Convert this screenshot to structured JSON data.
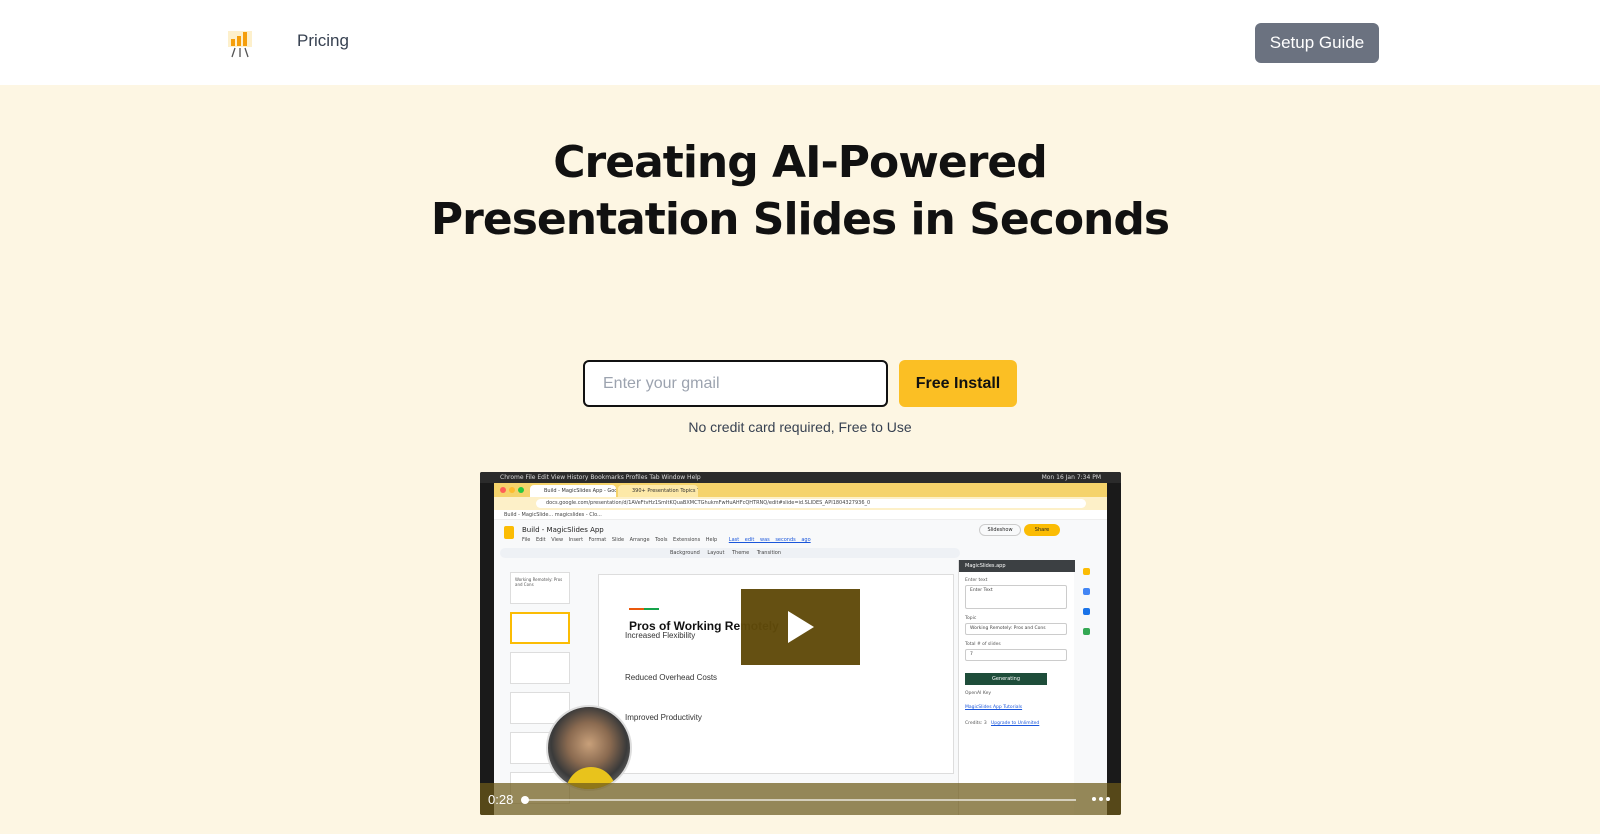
{
  "header": {
    "logo_icon": "bar-chart-easel-icon",
    "nav_pricing": "Pricing",
    "setup_guide": "Setup Guide"
  },
  "hero": {
    "title": "Creating AI-Powered Presentation Slides in Seconds",
    "email_placeholder": "Enter your gmail",
    "email_value": "",
    "install_button": "Free Install",
    "note": "No credit card required, Free to Use"
  },
  "video": {
    "time": "0:28",
    "progress": 0.0,
    "play_icon": "play-icon",
    "more_icon": "more-dots-icon",
    "screen": {
      "mac_menu": "Chrome   File   Edit   View   History   Bookmarks   Profiles   Tab   Window   Help",
      "mac_clock": "Mon 16 Jan  7:34 PM",
      "tab_1": "Build - MagicSlides App - Goo",
      "tab_2": "390+ Presentation Topics Th",
      "url": "docs.google.com/presentation/d/1AVeFtvHz1SmItKQuaBXMCTGhukmFwHuAHFcQHTRNQ/edit#slide=id.SLIDES_API1804327936_0",
      "bookmarks": "Build - MagicSlide...     magicslides - Clo...",
      "doc_title": "Build - MagicSlides App",
      "doc_menu": "File Edit View Insert Format Slide Arrange Tools Extensions Help",
      "last_edit": "Last edit was seconds ago",
      "toolbar": "Background   Layout   Theme   Transition",
      "slideshow": "Slideshow",
      "share": "Share",
      "thumb_1": "Working Remotely: Pros and Cons",
      "slide_heading": "Pros of Working Remotely",
      "slide_items": [
        "Increased Flexibility",
        "Reduced Overhead Costs",
        "Improved Productivity"
      ],
      "panel": {
        "title": "MagicSlides.app",
        "enter_text_label": "Enter text",
        "enter_text_placeholder": "Enter Text",
        "topic_label": "Topic",
        "topic_value": "Working Remotely: Pros and Cons",
        "slides_label": "Total # of slides",
        "slides_value": "7",
        "generating": "Generating",
        "openai_key": "OpenAI Key",
        "tutorials": "MagicSlides App Tutorials",
        "credits": "Credits: 3",
        "upgrade": "Upgrade to Unlimited"
      }
    }
  },
  "colors": {
    "page_bg": "#fdf6e3",
    "accent": "#fbbf24",
    "setup_button": "#6b7280",
    "video_overlay": "#604a0a"
  }
}
